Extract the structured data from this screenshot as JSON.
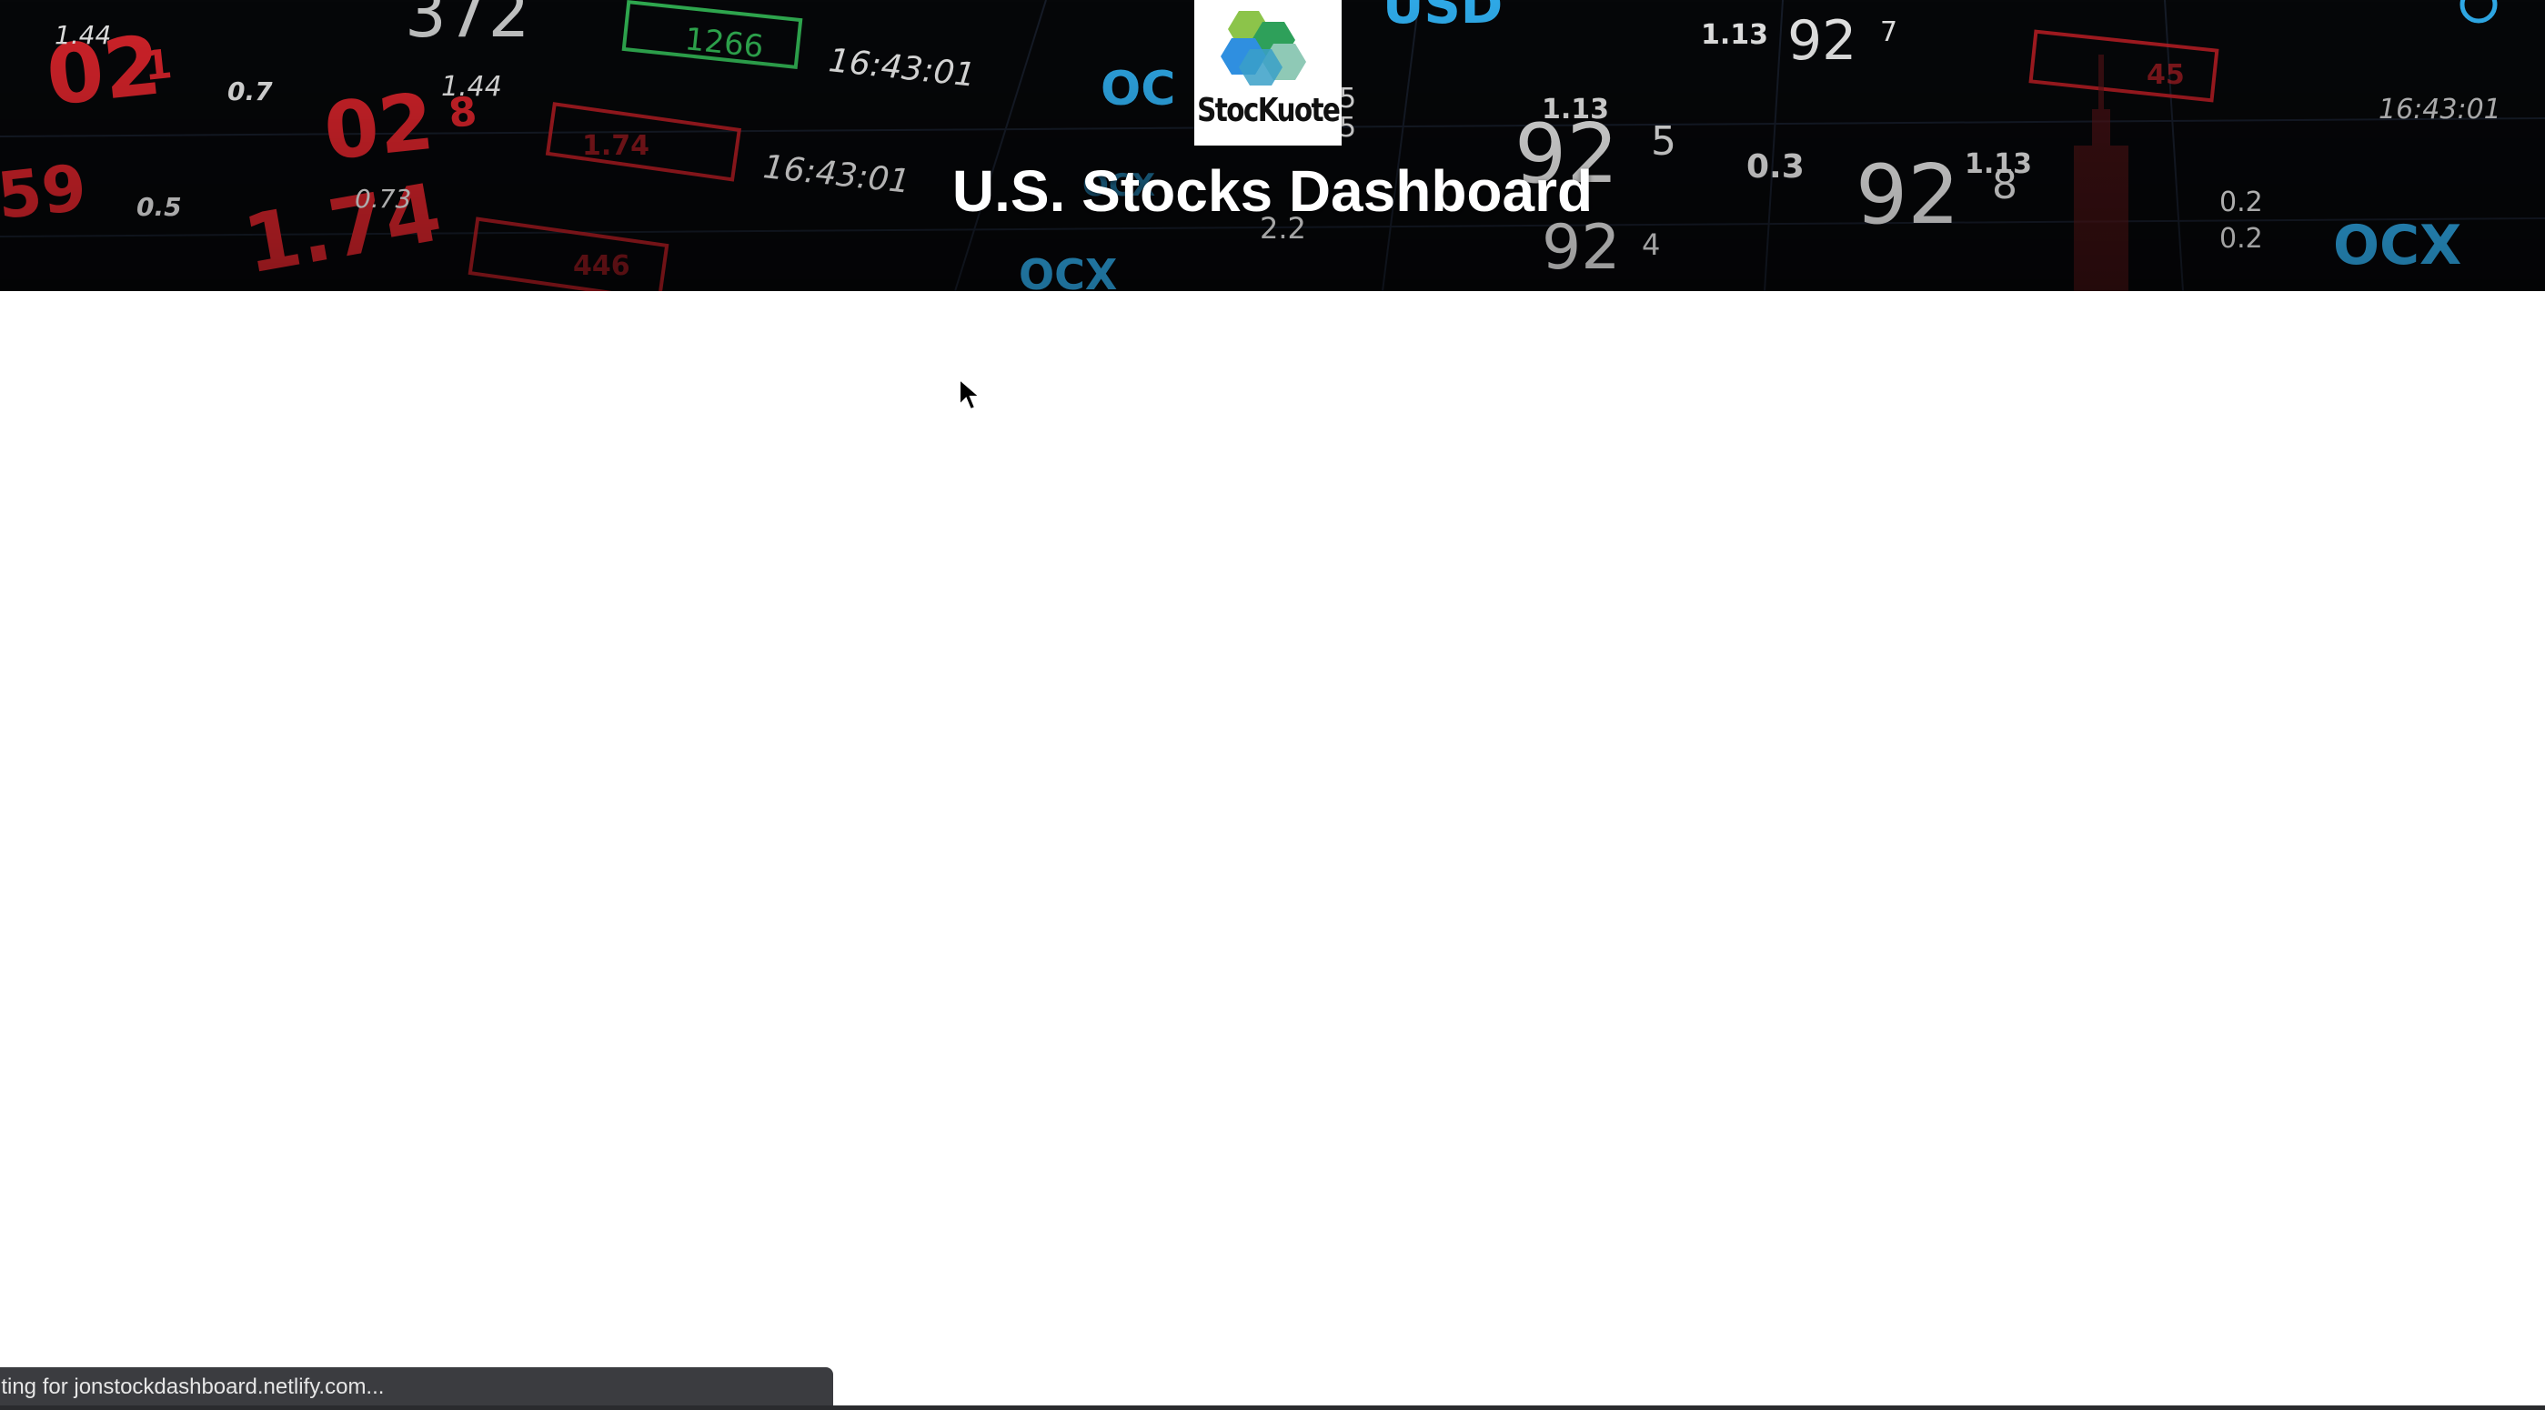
{
  "header": {
    "logo_text": "StocKuote",
    "title": "U.S. Stocks Dashboard"
  },
  "status_bar": {
    "text": "iting for jonstockdashboard.netlify.com..."
  },
  "background_ticker": {
    "texts": [
      "1.44",
      "02",
      "1",
      "0.7",
      "372",
      "1266",
      "16:43:01",
      "OC",
      "USD",
      "1.44",
      "028",
      "1.74",
      "16:43:01",
      "0.5",
      "0.73",
      "174",
      "59",
      "OCX",
      "2.2",
      "1.13",
      "925",
      "0.3",
      "928",
      "1.13",
      "927",
      "1.13",
      "924",
      "0.2",
      "0.2",
      "OCX",
      "16:43:01",
      "45",
      "446",
      "5",
      "5"
    ]
  },
  "icons": {
    "logo": "stockuote-hexagon-logo-icon",
    "cursor": "mouse-pointer-icon"
  },
  "colors": {
    "banner_background": "#050608",
    "ticker_red": "#d2232a",
    "ticker_blue": "#2ea8e6",
    "ticker_green": "#2fa84f",
    "ticker_white": "#e8e8e8",
    "status_bar_background": "#3b3c40"
  }
}
